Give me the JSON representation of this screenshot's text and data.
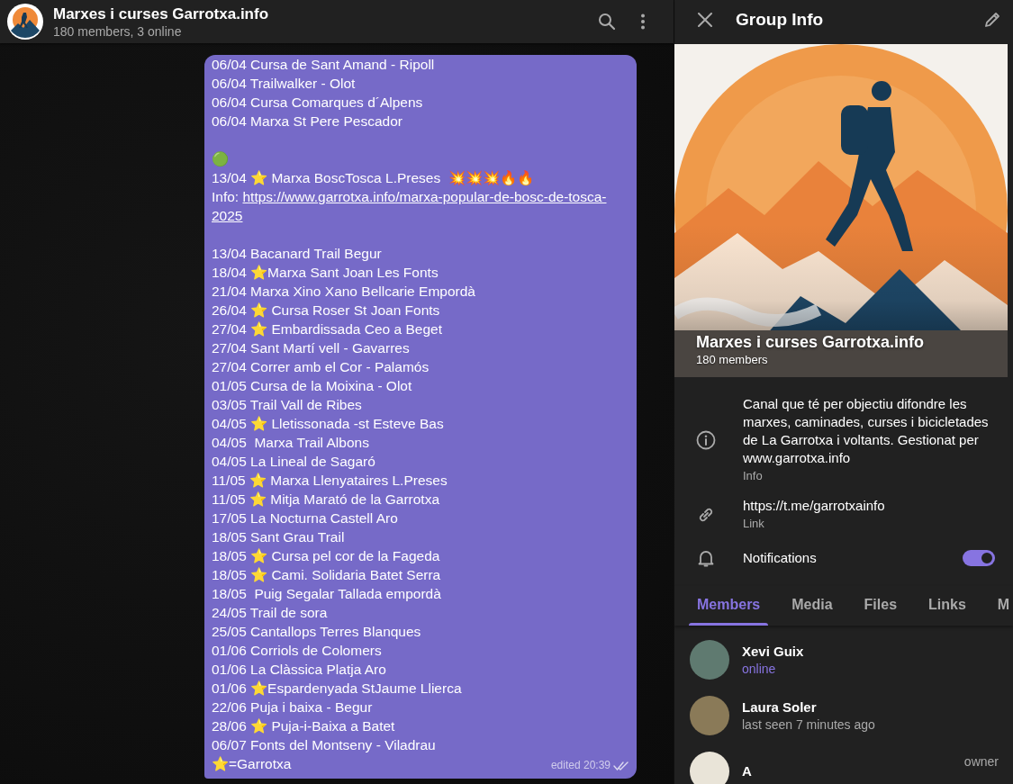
{
  "chat": {
    "title": "Marxes i curses Garrotxa.info",
    "subtitle": "180 members, 3 online",
    "message": {
      "lines": [
        {
          "kind": "text",
          "text": "06/04 Cursa de Sant Amand - Ripoll"
        },
        {
          "kind": "text",
          "text": "06/04 Trailwalker - Olot"
        },
        {
          "kind": "text",
          "text": "06/04 Cursa Comarques d´Alpens"
        },
        {
          "kind": "text",
          "text": "06/04 Marxa St Pere Pescador"
        },
        {
          "kind": "gap"
        },
        {
          "kind": "text",
          "text": "🟢"
        },
        {
          "kind": "text",
          "text": "13/04 ⭐ Marxa BoscTosca L.Preses  💥💥💥🔥🔥"
        },
        {
          "kind": "link",
          "prefix": "Info: ",
          "url": "https://www.garrotxa.info/marxa-popular-de-bosc-de-tosca-"
        },
        {
          "kind": "link",
          "url": "2025"
        },
        {
          "kind": "gap"
        },
        {
          "kind": "text",
          "text": "13/04 Bacanard Trail Begur"
        },
        {
          "kind": "text",
          "text": "18/04 ⭐Marxa Sant Joan Les Fonts"
        },
        {
          "kind": "text",
          "text": "21/04 Marxa Xino Xano Bellcarie Empordà"
        },
        {
          "kind": "text",
          "text": "26/04 ⭐ Cursa Roser St Joan Fonts"
        },
        {
          "kind": "text",
          "text": "27/04 ⭐ Embardissada Ceo a Beget"
        },
        {
          "kind": "text",
          "text": "27/04 Sant Martí vell - Gavarres"
        },
        {
          "kind": "text",
          "text": "27/04 Correr amb el Cor - Palamós"
        },
        {
          "kind": "text",
          "text": "01/05 Cursa de la Moixina - Olot"
        },
        {
          "kind": "text",
          "text": "03/05 Trail Vall de Ribes"
        },
        {
          "kind": "text",
          "text": "04/05 ⭐ Lletissonada -st Esteve Bas"
        },
        {
          "kind": "text",
          "text": "04/05  Marxa Trail Albons"
        },
        {
          "kind": "text",
          "text": "04/05 La Lineal de Sagaró"
        },
        {
          "kind": "text",
          "text": "11/05 ⭐ Marxa Llenyataires L.Preses"
        },
        {
          "kind": "text",
          "text": "11/05 ⭐ Mitja Marató de la Garrotxa"
        },
        {
          "kind": "text",
          "text": "17/05 La Nocturna Castell Aro"
        },
        {
          "kind": "text",
          "text": "18/05 Sant Grau Trail"
        },
        {
          "kind": "text",
          "text": "18/05 ⭐ Cursa pel cor de la Fageda"
        },
        {
          "kind": "text",
          "text": "18/05 ⭐ Cami. Solidaria Batet Serra"
        },
        {
          "kind": "text",
          "text": "18/05  Puig Segalar Tallada empordà"
        },
        {
          "kind": "text",
          "text": "24/05 Trail de sora"
        },
        {
          "kind": "text",
          "text": "25/05 Cantallops Terres Blanques"
        },
        {
          "kind": "text",
          "text": "01/06 Corriols de Colomers"
        },
        {
          "kind": "text",
          "text": "01/06 La Clàssica Platja Aro"
        },
        {
          "kind": "text",
          "text": "01/06 ⭐Espardenyada StJaume Llierca"
        },
        {
          "kind": "text",
          "text": "22/06 Puja i baixa - Begur"
        },
        {
          "kind": "text",
          "text": "28/06 ⭐ Puja-i-Baixa a Batet"
        },
        {
          "kind": "text",
          "text": "06/07 Fonts del Montseny - Viladrau"
        },
        {
          "kind": "text",
          "text": "⭐=Garrotxa"
        }
      ],
      "meta": "edited 20:39",
      "read": true
    }
  },
  "group_info": {
    "title": "Group Info",
    "name": "Marxes i curses Garrotxa.info",
    "members_count": "180 members",
    "rows": [
      {
        "kind": "info",
        "text": "Canal que té per objectiu difondre les marxes, caminades, curses i bicicletades de La Garrotxa i voltants. Gestionat per www.garrotxa.info",
        "caption": "Info"
      },
      {
        "kind": "link",
        "text": "https://t.me/garrotxainfo",
        "caption": "Link"
      },
      {
        "kind": "toggle",
        "text": "Notifications",
        "on": true
      }
    ],
    "tabs": [
      {
        "label": "Members",
        "selected": true
      },
      {
        "label": "Media",
        "selected": false
      },
      {
        "label": "Files",
        "selected": false
      },
      {
        "label": "Links",
        "selected": false
      },
      {
        "label": "M",
        "selected": false
      }
    ],
    "members": [
      {
        "name": "Xevi Guix",
        "status": "online",
        "online": true,
        "color": "#5f7a70"
      },
      {
        "name": "Laura Soler",
        "status": "last seen 7 minutes ago",
        "online": false,
        "color": "#8a7a58"
      },
      {
        "name": "A",
        "role": "owner",
        "color": "#e9e4d8"
      }
    ]
  }
}
